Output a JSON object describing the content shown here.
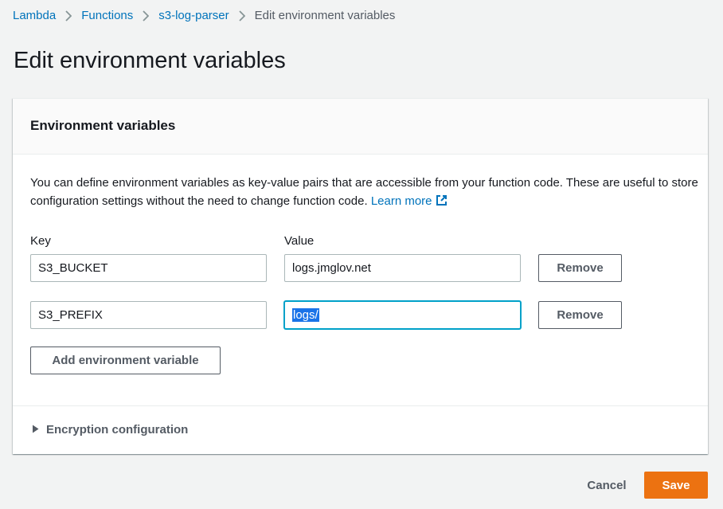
{
  "breadcrumb": {
    "items": [
      "Lambda",
      "Functions",
      "s3-log-parser"
    ],
    "current": "Edit environment variables"
  },
  "page": {
    "title": "Edit environment variables"
  },
  "panel": {
    "title": "Environment variables",
    "description": "You can define environment variables as key-value pairs that are accessible from your function code. These are useful to store configuration settings without the need to change function code.",
    "learn_more": "Learn more",
    "key_label": "Key",
    "value_label": "Value",
    "rows": [
      {
        "key": "S3_BUCKET",
        "value": "logs.jmglov.net",
        "remove_label": "Remove"
      },
      {
        "key": "S3_PREFIX",
        "value": "logs/",
        "remove_label": "Remove"
      }
    ],
    "add_label": "Add environment variable",
    "encryption_label": "Encryption configuration"
  },
  "footer": {
    "cancel_label": "Cancel",
    "save_label": "Save"
  },
  "colors": {
    "link": "#0073bb",
    "primary_button": "#ec7211",
    "focus_ring": "#00a1c9",
    "selection": "#1a73e8"
  },
  "icons": {
    "breadcrumb_separator": "chevron-right-icon",
    "learn_more": "external-link-icon",
    "expander": "caret-right-icon"
  }
}
